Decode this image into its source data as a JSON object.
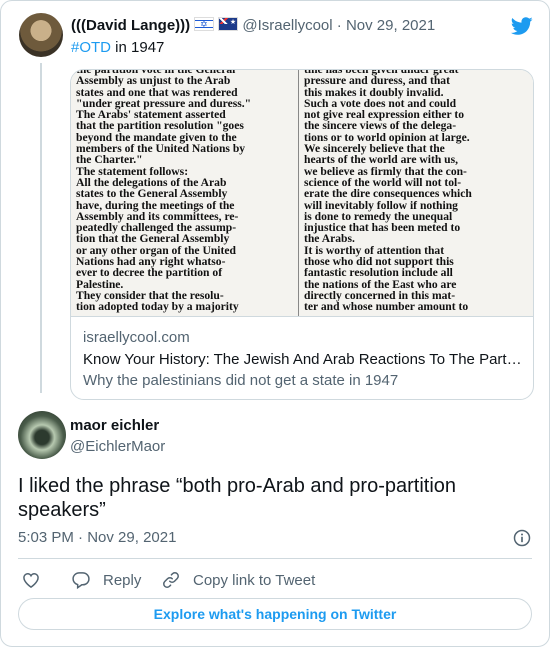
{
  "parent_tweet": {
    "display_name": "(((David Lange)))",
    "flags": [
      "israel-flag",
      "australia-flag"
    ],
    "handle": "@Israellycool",
    "separator": "·",
    "date": "Nov 29, 2021",
    "hashtag": "#OTD",
    "text_rest": " in 1947",
    "link_card": {
      "image_left_text": "the partition vote in the General\nAssembly as unjust to the Arab\nstates and one that was rendered\n\"under great pressure and duress.\"\n  The Arabs' statement asserted\nthat the partition resolution \"goes\nbeyond the mandate given to the\nmembers of the United Nations by\nthe Charter.\"\n  The statement follows:\n  All the delegations of the Arab\nstates to the General Assembly\nhave, during the meetings of the\nAssembly and its committees, re-\npeatedly challenged the assump-\ntion that the General Assembly\nor any other organ of the United\nNations had any right whatso-\never to decree the partition of\nPalestine.\n  They consider that the resolu-\ntion adopted today by a majority",
      "image_right_text": "tine has been given under great\npressure and duress, and that\nthis makes it doubly invalid.\nSuch a vote does not and could\nnot give real expression either to\nthe sincere views of the delega-\ntions or to world opinion at large.\n  We sincerely believe that the\nhearts of the world are with us,\nwe believe as firmly that the con-\nscience of the world will not tol-\nerate the dire consequences which\nwill inevitably follow if nothing\nis done to remedy the unequal\ninjustice that has been meted to\nthe Arabs.\n  It is worthy of attention that\nthose who did not support this\nfantastic resolution include all\nthe nations of the East who are\ndirectly concerned in this mat-\nter and whose number amount to",
      "domain": "israellycool.com",
      "title": "Know Your History: The Jewish And Arab Reactions To The Partition Vote",
      "description": "Why the palestinians did not get a state in 1947"
    }
  },
  "main_tweet": {
    "display_name": "maor eichler",
    "handle": "@EichlerMaor",
    "text": "I liked the phrase “both pro-Arab and pro-partition speakers”",
    "time": "5:03 PM",
    "separator": "·",
    "date": "Nov 29, 2021"
  },
  "actions": {
    "reply_label": "Reply",
    "copy_link_label": "Copy link to Tweet"
  },
  "explore_label": "Explore what's happening on Twitter",
  "colors": {
    "accent": "#1d9bf0",
    "secondary_text": "#536471",
    "border": "#cfd9de"
  },
  "icons": [
    "twitter-bird-icon",
    "heart-icon",
    "reply-icon",
    "link-icon",
    "info-icon"
  ]
}
